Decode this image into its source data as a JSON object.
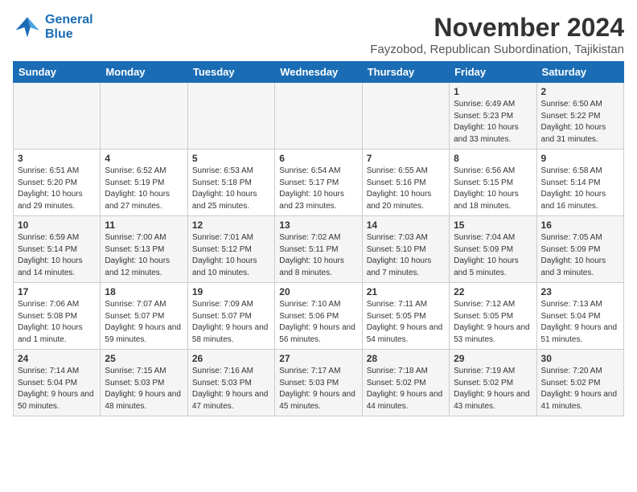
{
  "logo": {
    "line1": "General",
    "line2": "Blue"
  },
  "title": "November 2024",
  "subtitle": "Fayzobod, Republican Subordination, Tajikistan",
  "weekdays": [
    "Sunday",
    "Monday",
    "Tuesday",
    "Wednesday",
    "Thursday",
    "Friday",
    "Saturday"
  ],
  "weeks": [
    [
      {
        "day": "",
        "info": ""
      },
      {
        "day": "",
        "info": ""
      },
      {
        "day": "",
        "info": ""
      },
      {
        "day": "",
        "info": ""
      },
      {
        "day": "",
        "info": ""
      },
      {
        "day": "1",
        "info": "Sunrise: 6:49 AM\nSunset: 5:23 PM\nDaylight: 10 hours and 33 minutes."
      },
      {
        "day": "2",
        "info": "Sunrise: 6:50 AM\nSunset: 5:22 PM\nDaylight: 10 hours and 31 minutes."
      }
    ],
    [
      {
        "day": "3",
        "info": "Sunrise: 6:51 AM\nSunset: 5:20 PM\nDaylight: 10 hours and 29 minutes."
      },
      {
        "day": "4",
        "info": "Sunrise: 6:52 AM\nSunset: 5:19 PM\nDaylight: 10 hours and 27 minutes."
      },
      {
        "day": "5",
        "info": "Sunrise: 6:53 AM\nSunset: 5:18 PM\nDaylight: 10 hours and 25 minutes."
      },
      {
        "day": "6",
        "info": "Sunrise: 6:54 AM\nSunset: 5:17 PM\nDaylight: 10 hours and 23 minutes."
      },
      {
        "day": "7",
        "info": "Sunrise: 6:55 AM\nSunset: 5:16 PM\nDaylight: 10 hours and 20 minutes."
      },
      {
        "day": "8",
        "info": "Sunrise: 6:56 AM\nSunset: 5:15 PM\nDaylight: 10 hours and 18 minutes."
      },
      {
        "day": "9",
        "info": "Sunrise: 6:58 AM\nSunset: 5:14 PM\nDaylight: 10 hours and 16 minutes."
      }
    ],
    [
      {
        "day": "10",
        "info": "Sunrise: 6:59 AM\nSunset: 5:14 PM\nDaylight: 10 hours and 14 minutes."
      },
      {
        "day": "11",
        "info": "Sunrise: 7:00 AM\nSunset: 5:13 PM\nDaylight: 10 hours and 12 minutes."
      },
      {
        "day": "12",
        "info": "Sunrise: 7:01 AM\nSunset: 5:12 PM\nDaylight: 10 hours and 10 minutes."
      },
      {
        "day": "13",
        "info": "Sunrise: 7:02 AM\nSunset: 5:11 PM\nDaylight: 10 hours and 8 minutes."
      },
      {
        "day": "14",
        "info": "Sunrise: 7:03 AM\nSunset: 5:10 PM\nDaylight: 10 hours and 7 minutes."
      },
      {
        "day": "15",
        "info": "Sunrise: 7:04 AM\nSunset: 5:09 PM\nDaylight: 10 hours and 5 minutes."
      },
      {
        "day": "16",
        "info": "Sunrise: 7:05 AM\nSunset: 5:09 PM\nDaylight: 10 hours and 3 minutes."
      }
    ],
    [
      {
        "day": "17",
        "info": "Sunrise: 7:06 AM\nSunset: 5:08 PM\nDaylight: 10 hours and 1 minute."
      },
      {
        "day": "18",
        "info": "Sunrise: 7:07 AM\nSunset: 5:07 PM\nDaylight: 9 hours and 59 minutes."
      },
      {
        "day": "19",
        "info": "Sunrise: 7:09 AM\nSunset: 5:07 PM\nDaylight: 9 hours and 58 minutes."
      },
      {
        "day": "20",
        "info": "Sunrise: 7:10 AM\nSunset: 5:06 PM\nDaylight: 9 hours and 56 minutes."
      },
      {
        "day": "21",
        "info": "Sunrise: 7:11 AM\nSunset: 5:05 PM\nDaylight: 9 hours and 54 minutes."
      },
      {
        "day": "22",
        "info": "Sunrise: 7:12 AM\nSunset: 5:05 PM\nDaylight: 9 hours and 53 minutes."
      },
      {
        "day": "23",
        "info": "Sunrise: 7:13 AM\nSunset: 5:04 PM\nDaylight: 9 hours and 51 minutes."
      }
    ],
    [
      {
        "day": "24",
        "info": "Sunrise: 7:14 AM\nSunset: 5:04 PM\nDaylight: 9 hours and 50 minutes."
      },
      {
        "day": "25",
        "info": "Sunrise: 7:15 AM\nSunset: 5:03 PM\nDaylight: 9 hours and 48 minutes."
      },
      {
        "day": "26",
        "info": "Sunrise: 7:16 AM\nSunset: 5:03 PM\nDaylight: 9 hours and 47 minutes."
      },
      {
        "day": "27",
        "info": "Sunrise: 7:17 AM\nSunset: 5:03 PM\nDaylight: 9 hours and 45 minutes."
      },
      {
        "day": "28",
        "info": "Sunrise: 7:18 AM\nSunset: 5:02 PM\nDaylight: 9 hours and 44 minutes."
      },
      {
        "day": "29",
        "info": "Sunrise: 7:19 AM\nSunset: 5:02 PM\nDaylight: 9 hours and 43 minutes."
      },
      {
        "day": "30",
        "info": "Sunrise: 7:20 AM\nSunset: 5:02 PM\nDaylight: 9 hours and 41 minutes."
      }
    ]
  ]
}
